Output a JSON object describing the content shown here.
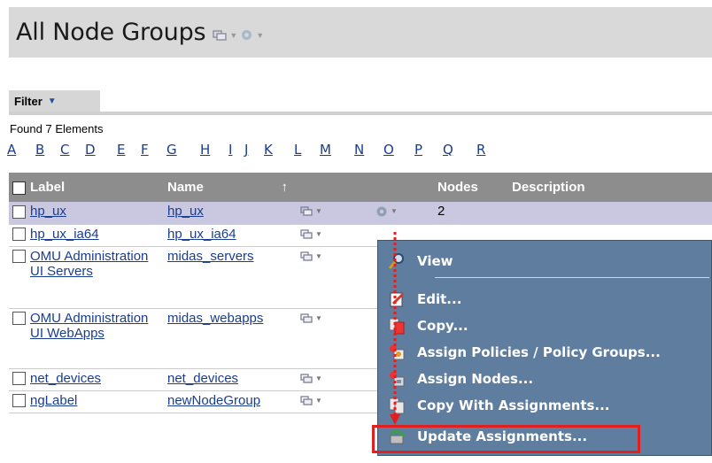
{
  "title": "All Node Groups",
  "filter": {
    "label": "Filter"
  },
  "found_text": "Found 7 Elements",
  "alphabet": [
    "A",
    "B",
    "C",
    "D",
    "E",
    "F",
    "G",
    "H",
    "I",
    "J",
    "K",
    "L",
    "M",
    "N",
    "O",
    "P",
    "Q",
    "R"
  ],
  "table": {
    "headers": {
      "label": "Label",
      "name": "Name",
      "nodes": "Nodes",
      "description": "Description"
    },
    "rows": [
      {
        "label": "hp_ux",
        "name": "hp_ux",
        "nodes": "2",
        "selected": true
      },
      {
        "label": "hp_ux_ia64",
        "name": "hp_ux_ia64",
        "nodes": ""
      },
      {
        "label": "OMU Administration UI Servers",
        "name": "midas_servers",
        "nodes": ""
      },
      {
        "label": "OMU Administration UI WebApps",
        "name": "midas_webapps",
        "nodes": ""
      },
      {
        "label": "net_devices",
        "name": "net_devices",
        "nodes": ""
      },
      {
        "label": "ngLabel",
        "name": "newNodeGroup",
        "nodes": ""
      }
    ]
  },
  "context_menu": {
    "items": [
      {
        "label": "View",
        "icon": "magnifier-icon"
      },
      {
        "label": "Edit...",
        "icon": "edit-icon"
      },
      {
        "label": "Copy...",
        "icon": "copy-icon"
      },
      {
        "label": "Assign Policies / Policy Groups...",
        "icon": "assign-policies-icon"
      },
      {
        "label": "Assign Nodes...",
        "icon": "assign-nodes-icon"
      },
      {
        "label": "Copy With Assignments...",
        "icon": "copy-assignments-icon"
      },
      {
        "label": "Update Assignments...",
        "icon": "update-assignments-icon"
      }
    ]
  },
  "colors": {
    "menu_bg": "#5f7d9e",
    "header_bg": "#8d8d8d",
    "selected_row": "#c9c8e0",
    "highlight": "#e0201f"
  }
}
